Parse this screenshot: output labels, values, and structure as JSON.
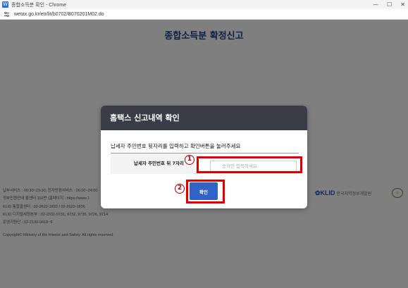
{
  "window": {
    "app_icon": "W",
    "title": "종합소득분 확인 - Chrome",
    "url": "wetax.go.kr/etr/lit/b0702/B070201M02.do",
    "minimize": "—",
    "maximize": "☐",
    "close": "✕"
  },
  "page": {
    "title": "종합소득분 확정신고"
  },
  "footer": {
    "lines": [
      "납부서비스 : 00:30~23:30, 전자민원서비스 : 06:00~24:00",
      "정부민원안내 콜센터 110번 (홈페이지 : https://www.1",
      "KLID 통합콜센터 : 02-2622-1832 / 02-2622-1836",
      "KLID 디지털세정본부 : 02-2031-9731, 9732, 9735, 9726, 9714",
      "운영지원단 : 02-2139-9418~9"
    ],
    "copyright": "Copyright© Ministry of the Interior and Safety. All rights reserved.",
    "klid_mark": "✿KLID",
    "klid_name": "한국지역정보개발원"
  },
  "modal": {
    "title": "홈택스 신고내역 확인",
    "description": "납세자 주민번호 뒷자리를 입력하고 확인버튼을 눌러주세요",
    "field_label": "납세자 주민번호 뒤 7자리",
    "field_placeholder": "숫자만 입력하세요.",
    "field_value": "",
    "confirm_label": "확인"
  },
  "annotations": {
    "marker_1": "1",
    "marker_2": "2",
    "highlight_color": "#e00000"
  }
}
